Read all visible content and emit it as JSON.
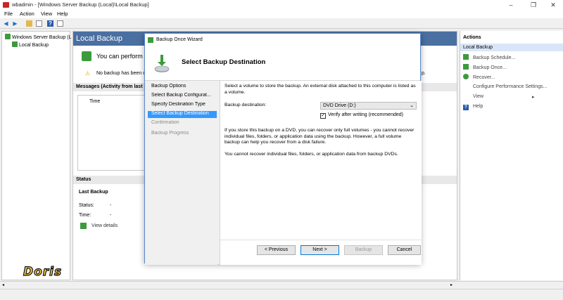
{
  "window": {
    "title": "wbadmin - [Windows Server Backup (Local)\\Local Backup]",
    "icons": {
      "app": "wbadmin-icon",
      "minimize": "minimize-icon",
      "maximize": "maximize-icon",
      "close": "close-icon"
    }
  },
  "menu": {
    "file": "File",
    "action": "Action",
    "view": "View",
    "help": "Help"
  },
  "tree": {
    "root": "Windows Server Backup (L",
    "child": "Local Backup"
  },
  "center": {
    "header": "Local Backup",
    "banner": "You can perform",
    "warning": "No backup has been c",
    "warning_tail": "p.",
    "messages_title": "Messages (Activity from last",
    "col_time": "Time",
    "status_title": "Status",
    "last_backup": "Last Backup",
    "status_label": "Status:",
    "status_value": "-",
    "time_label": "Time:",
    "time_value": "-",
    "view_details": "View details"
  },
  "actions": {
    "header": "Actions",
    "section": "Local Backup",
    "items": [
      "Backup Schedule...",
      "Backup Once...",
      "Recover...",
      "Configure Performance Settings...",
      "View",
      "Help"
    ]
  },
  "dialog": {
    "title": "Backup Once Wizard",
    "heading": "Select Backup Destination",
    "steps": [
      "Backup Options",
      "Select Backup Configurat...",
      "Specify Destination Type",
      "Select Backup Destination",
      "Confirmation",
      "Backup Progress"
    ],
    "intro": "Select a volume to store the backup. An external disk attached to this computer is listed as a volume.",
    "dest_label": "Backup destination:",
    "dest_value": "DVD Drive (D:)",
    "verify_label": "Verify after writing (recommended)",
    "verify_checked": "✓",
    "info1": "If you store this backup on a DVD, you can recover only full volumes - you cannot recover individual files, folders, or application data using the backup. However, a full volume backup can help you recover from a disk failure.",
    "info2": "You cannot recover individual files, folders, or application data from backup DVDs.",
    "buttons": {
      "previous": "< Previous",
      "next": "Next >",
      "backup": "Backup",
      "cancel": "Cancel"
    }
  },
  "watermark": "Doris",
  "colors": {
    "header_blue": "#4a6fa1",
    "selection": "#3399ff",
    "warning": "#f2c200"
  }
}
